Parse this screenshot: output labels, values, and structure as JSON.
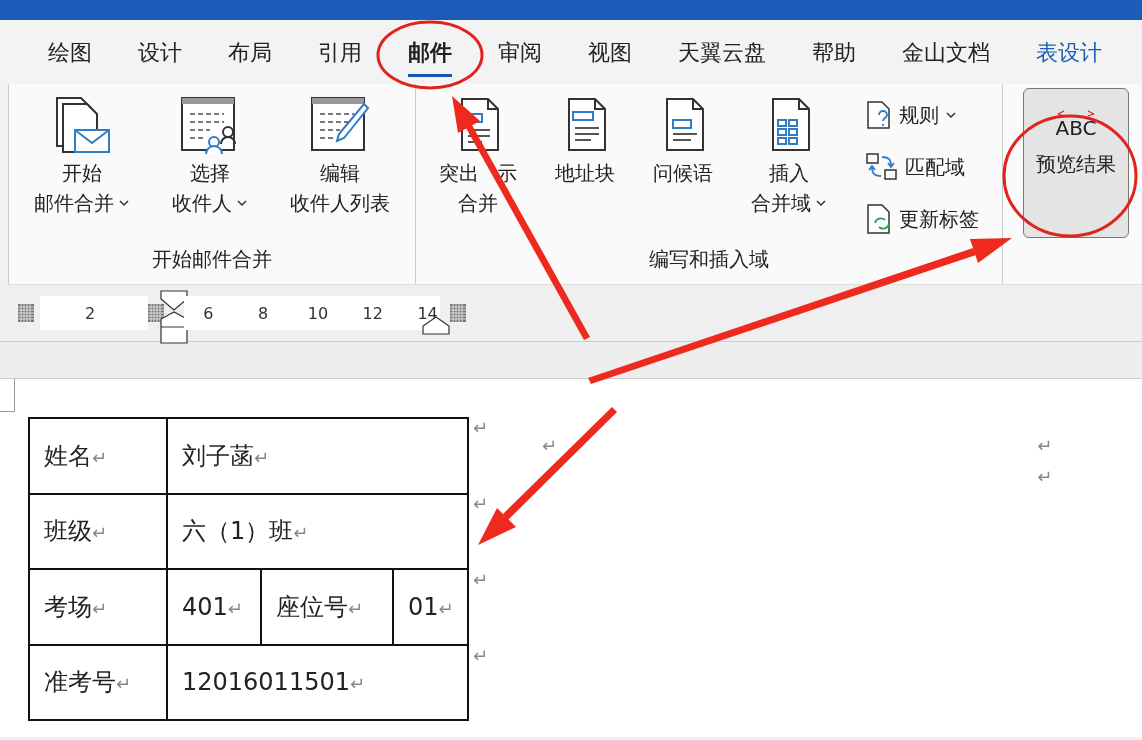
{
  "tabs": [
    {
      "label": "绘图",
      "selected": false,
      "contextual": false
    },
    {
      "label": "设计",
      "selected": false,
      "contextual": false
    },
    {
      "label": "布局",
      "selected": false,
      "contextual": false
    },
    {
      "label": "引用",
      "selected": false,
      "contextual": false
    },
    {
      "label": "邮件",
      "selected": true,
      "contextual": false
    },
    {
      "label": "审阅",
      "selected": false,
      "contextual": false
    },
    {
      "label": "视图",
      "selected": false,
      "contextual": false
    },
    {
      "label": "天翼云盘",
      "selected": false,
      "contextual": false
    },
    {
      "label": "帮助",
      "selected": false,
      "contextual": false
    },
    {
      "label": "金山文档",
      "selected": false,
      "contextual": false
    },
    {
      "label": "表设计",
      "selected": false,
      "contextual": true
    }
  ],
  "ribbon": {
    "groups": [
      {
        "label": "开始邮件合并",
        "buttons": [
          {
            "kind": "big",
            "lines": [
              "开始",
              "邮件合并"
            ],
            "dropdown": true
          },
          {
            "kind": "big",
            "lines": [
              "选择",
              "收件人"
            ],
            "dropdown": true
          },
          {
            "kind": "big",
            "lines": [
              "编辑",
              "收件人列表"
            ],
            "dropdown": false
          }
        ]
      },
      {
        "label": "编写和插入域",
        "buttons": [
          {
            "kind": "big",
            "lines": [
              "突出 示",
              "合并"
            ],
            "dropdown": false
          },
          {
            "kind": "big",
            "lines": [
              "地址块"
            ],
            "dropdown": false
          },
          {
            "kind": "big",
            "lines": [
              "问候语"
            ],
            "dropdown": false
          },
          {
            "kind": "big",
            "lines": [
              "插入",
              "合并域"
            ],
            "dropdown": true
          },
          {
            "kind": "small",
            "lines": [
              "规则"
            ],
            "dropdown": true
          },
          {
            "kind": "small",
            "lines": [
              "匹配域"
            ],
            "dropdown": false
          },
          {
            "kind": "small",
            "lines": [
              "更新标签"
            ],
            "dropdown": false
          }
        ]
      },
      {
        "buttons": [
          {
            "kind": "preview",
            "icon_text": "ABC",
            "lines": [
              "预览结果"
            ],
            "dropdown": false
          }
        ]
      }
    ]
  },
  "ruler": {
    "left_numbers": [
      "2"
    ],
    "right_numbers": [
      "6",
      "8",
      "10",
      "12",
      "14"
    ]
  },
  "table": {
    "rows": [
      {
        "cells": [
          {
            "text": "姓名",
            "mark": "↵"
          },
          {
            "text": "刘子菡",
            "mark": "↵",
            "colspan": 3
          }
        ],
        "end_mark": "↵"
      },
      {
        "cells": [
          {
            "text": "班级",
            "mark": "↵"
          },
          {
            "text": "六（1）班",
            "mark": "↵",
            "colspan": 3
          }
        ],
        "end_mark": "↵"
      },
      {
        "cells": [
          {
            "text": "考场",
            "mark": "↵"
          },
          {
            "text": "401",
            "mark": "↵"
          },
          {
            "text": "座位号",
            "mark": "↵"
          },
          {
            "text": "01",
            "mark": "↵"
          }
        ],
        "end_mark": "↵"
      },
      {
        "cells": [
          {
            "text": "准考号",
            "mark": "↵"
          },
          {
            "text": "12016011501",
            "mark": "↵",
            "colspan": 3
          }
        ],
        "end_mark": "↵"
      }
    ]
  },
  "paragraph_marks": {
    "middle": [
      "↵"
    ],
    "right": [
      "↵",
      "↵"
    ]
  }
}
